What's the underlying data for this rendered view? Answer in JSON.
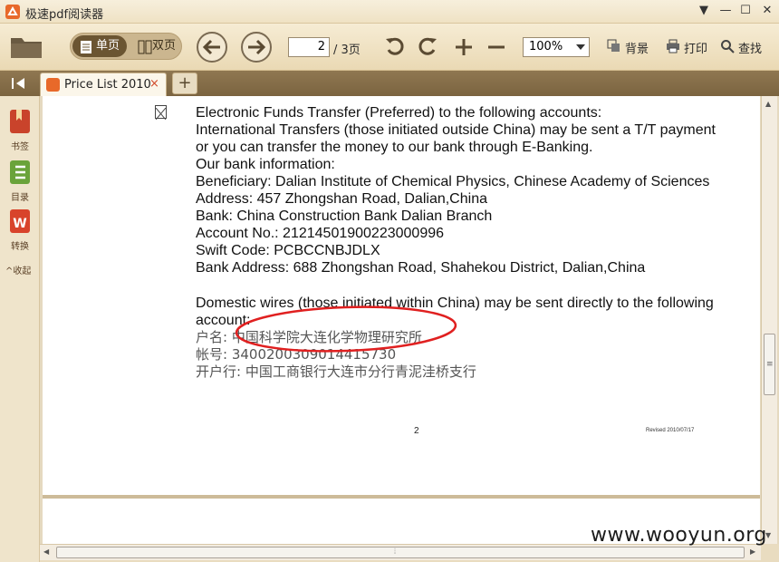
{
  "app": {
    "title": "极速pdf阅读器"
  },
  "window_controls": {
    "menu": "▼",
    "minimize": "—",
    "maximize": "☐",
    "close": "✕"
  },
  "toolbar": {
    "single_page": "单页",
    "double_page": "双页",
    "current_page": "2",
    "total_pages": "/ 3页",
    "zoom": "100%",
    "background_label": "背景",
    "print_label": "打印",
    "search_label": "查找"
  },
  "tabs": [
    {
      "label": "Price List 2010",
      "close": "×"
    }
  ],
  "new_tab": "+",
  "sidebar": {
    "items": [
      {
        "label": "书签",
        "icon": "bookmark-icon",
        "color": "#c9432b"
      },
      {
        "label": "目录",
        "icon": "toc-icon",
        "color": "#6aa33a"
      },
      {
        "label": "转换",
        "icon": "convert-icon",
        "color": "#d8432b"
      }
    ],
    "collapse": "^收起"
  },
  "document": {
    "lines": [
      "Electronic Funds Transfer (Preferred) to the following accounts:",
      "International Transfers (those initiated outside China) may be sent a T/T payment",
      "or you can transfer the money to our bank through E-Banking.",
      "Our bank information:",
      "Beneficiary: Dalian Institute of Chemical Physics, Chinese Academy of Sciences",
      "Address: 457 Zhongshan Road, Dalian,China",
      "Bank: China Construction Bank Dalian Branch",
      "Account No.: 21214501900223000996",
      "Swift Code: PCBCCNBJDLX",
      "Bank Address: 688 Zhongshan Road, Shahekou District, Dalian,China",
      "Domestic wires (those initiated within China) may be sent directly to the following",
      "account:"
    ],
    "cn_lines": [
      "户名: 中国科学院大连化学物理研究所",
      "帐号: 3400200309014415730",
      "开户行: 中国工商银行大连市分行青泥洼桥支行"
    ],
    "page_number": "2",
    "revised": "Revised 2010/07/17",
    "annotation_color": "#e02020"
  },
  "watermark": "www.wooyun.org"
}
